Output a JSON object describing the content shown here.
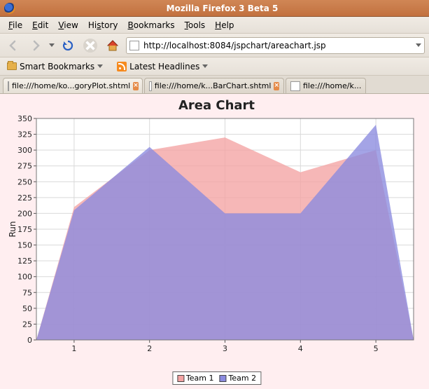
{
  "window": {
    "title": "Mozilla Firefox 3 Beta 5"
  },
  "menubar": {
    "file": "File",
    "edit": "Edit",
    "view": "View",
    "history": "History",
    "bookmarks": "Bookmarks",
    "tools": "Tools",
    "help": "Help"
  },
  "toolbar": {
    "url": "http://localhost:8084/jspchart/areachart.jsp"
  },
  "bookmarks_bar": {
    "smart": "Smart Bookmarks",
    "latest": "Latest Headlines"
  },
  "tabs": [
    {
      "label": "file:///home/ko...goryPlot.shtml"
    },
    {
      "label": "file:///home/k...BarChart.shtml"
    },
    {
      "label": "file:///home/k..."
    }
  ],
  "chart_data": {
    "type": "area",
    "title": "Area Chart",
    "xlabel": "",
    "ylabel": "Run",
    "categories": [
      "1",
      "2",
      "3",
      "4",
      "5"
    ],
    "series": [
      {
        "name": "Team 1",
        "color": "#f4a3a3",
        "values": [
          210,
          300,
          320,
          265,
          300
        ]
      },
      {
        "name": "Team 2",
        "color": "#8a8adf",
        "values": [
          205,
          305,
          200,
          200,
          340
        ]
      }
    ],
    "ylim": [
      0,
      350
    ],
    "yticks": [
      0,
      25,
      50,
      75,
      100,
      125,
      150,
      175,
      200,
      225,
      250,
      275,
      300,
      325,
      350
    ],
    "legend_position": "bottom"
  }
}
